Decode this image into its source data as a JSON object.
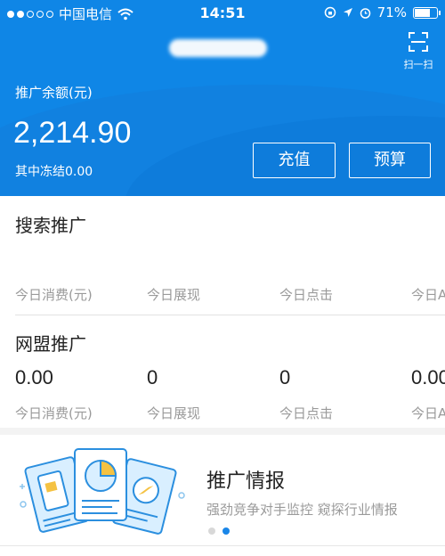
{
  "status_bar": {
    "carrier": "中国电信",
    "time": "14:51",
    "battery": "71%",
    "battery_level": 0.71
  },
  "header": {
    "scan_label": "扫一扫",
    "balance_label": "推广余额(元)",
    "balance_value": "2,214.90",
    "frozen_text": "其中冻结0.00",
    "recharge_label": "充值",
    "budget_label": "预算"
  },
  "search_promo": {
    "title": "搜索推广",
    "stats": [
      {
        "label": "今日消费(元)"
      },
      {
        "label": "今日展现"
      },
      {
        "label": "今日点击"
      },
      {
        "label": "今日A"
      }
    ]
  },
  "alliance_promo": {
    "title": "网盟推广",
    "stats": [
      {
        "value": "0.00",
        "label": "今日消费(元)"
      },
      {
        "value": "0",
        "label": "今日展现"
      },
      {
        "value": "0",
        "label": "今日点击"
      },
      {
        "value": "0.00",
        "label": "今日A"
      }
    ]
  },
  "banner": {
    "title": "推广情报",
    "subtitle": "强劲竞争对手监控 窥探行业情报",
    "active_page": 2,
    "page_count": 2
  },
  "colors": {
    "header_blue": "#0f86e6",
    "accent_blue": "#1a86e8",
    "muted_text": "#9a9a9a"
  }
}
